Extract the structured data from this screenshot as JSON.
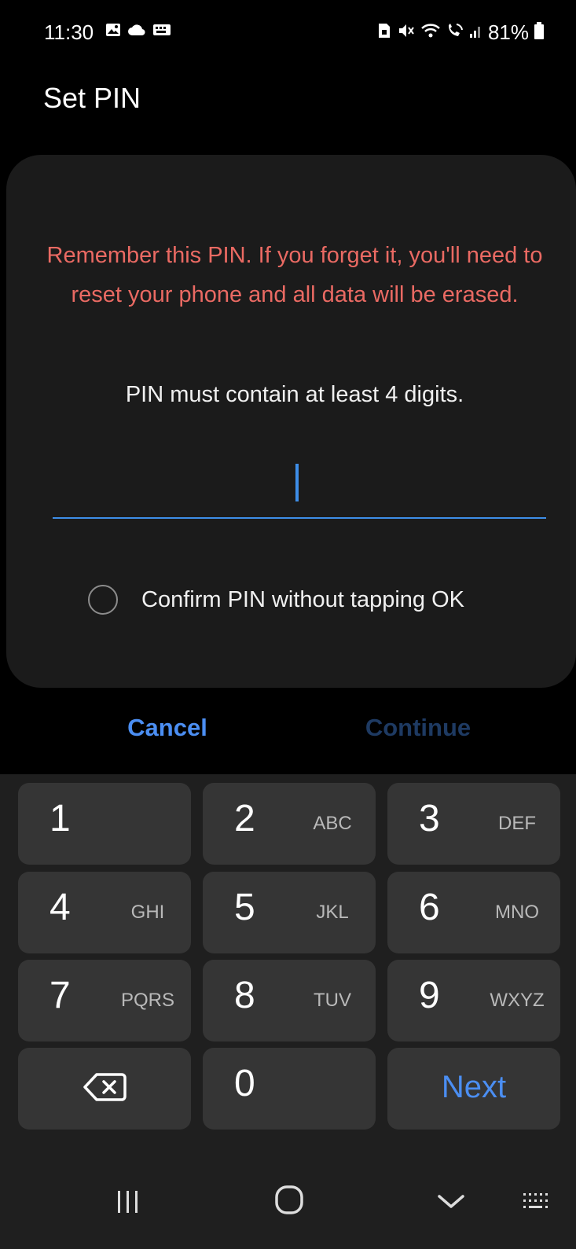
{
  "status_bar": {
    "time": "11:30",
    "left_icons": [
      "gallery-icon",
      "cloud-icon",
      "keyboard-badge-icon"
    ],
    "right_icons": [
      "sim-lock-icon",
      "mute-icon",
      "wifi-icon",
      "wifi-calling-icon",
      "signal-icon",
      "battery-icon"
    ],
    "battery_percent": "81%"
  },
  "header": {
    "title": "Set PIN"
  },
  "card": {
    "warning": "Remember this PIN. If you forget it, you'll need to reset your phone and all data will be erased.",
    "hint": "PIN must contain at least 4 digits.",
    "pin_value": "",
    "confirm_option": {
      "label": "Confirm PIN without tapping OK",
      "checked": false
    }
  },
  "actions": {
    "cancel_label": "Cancel",
    "continue_label": "Continue"
  },
  "keypad": {
    "keys": [
      {
        "digit": "1",
        "letters": ""
      },
      {
        "digit": "2",
        "letters": "ABC"
      },
      {
        "digit": "3",
        "letters": "DEF"
      },
      {
        "digit": "4",
        "letters": "GHI"
      },
      {
        "digit": "5",
        "letters": "JKL"
      },
      {
        "digit": "6",
        "letters": "MNO"
      },
      {
        "digit": "7",
        "letters": "PQRS"
      },
      {
        "digit": "8",
        "letters": "TUV"
      },
      {
        "digit": "9",
        "letters": "WXYZ"
      },
      {
        "digit": "0",
        "letters": ""
      }
    ],
    "backspace_icon": "backspace-icon",
    "next_label": "Next"
  },
  "nav_bar": {
    "icons": [
      "recent-apps-icon",
      "home-icon",
      "back-icon",
      "keyboard-icon"
    ]
  },
  "colors": {
    "accent": "#4b8ef2",
    "warning": "#ea6a63",
    "disabled": "#1e3a62",
    "card_bg": "#1b1b1b",
    "key_bg": "#353535"
  }
}
